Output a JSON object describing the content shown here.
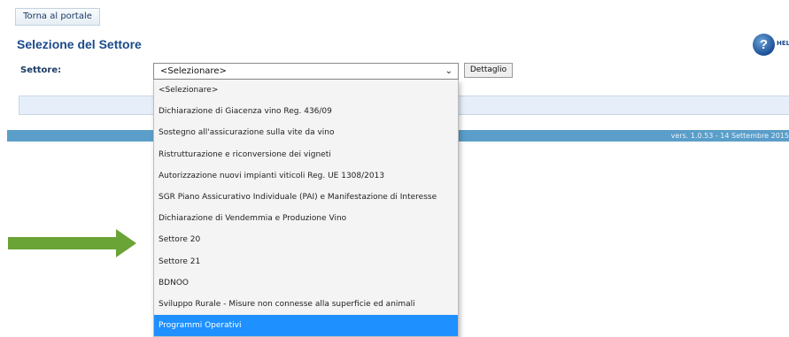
{
  "header": {
    "portal_button": "Torna al portale",
    "title": "Selezione del Settore",
    "help_label": "HEL",
    "help_icon": "help-icon"
  },
  "form": {
    "sector_label": "Settore:",
    "selected_value": "<Selezionare>",
    "detail_button": "Dettaglio"
  },
  "dropdown": {
    "options": [
      "<Selezionare>",
      "Dichiarazione di Giacenza vino Reg. 436/09",
      "Sostegno all'assicurazione sulla vite da vino",
      "Ristrutturazione e riconversione dei vigneti",
      "Autorizzazione nuovi impianti viticoli Reg. UE 1308/2013",
      "SGR Piano Assicurativo Individuale (PAI) e Manifestazione di Interesse",
      "Dichiarazione di Vendemmia e Produzione Vino",
      "Settore 20",
      "Settore 21",
      "BDNOO",
      "Sviluppo Rurale - Misure non connesse alla superficie ed animali",
      "Programmi Operativi"
    ],
    "highlighted_index": 11
  },
  "footer": {
    "version": "vers. 1.0.53 - 14 Settembre 2015"
  },
  "colors": {
    "title": "#1b4a8a",
    "footer_bar": "#5a9ec9",
    "highlight": "#1e90ff",
    "arrow": "#6aa336"
  }
}
